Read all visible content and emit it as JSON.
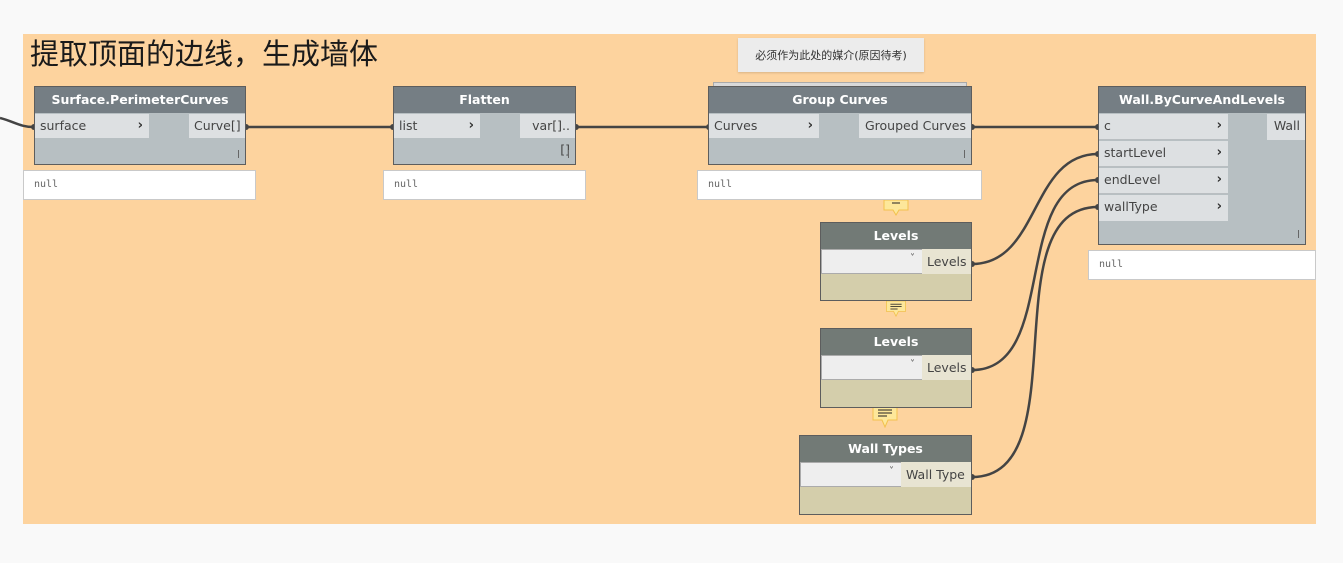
{
  "group": {
    "title": "提取顶面的边线，生成墙体",
    "background": "#fdd39e"
  },
  "note": {
    "text": "必须作为此处的媒介(原因待考)"
  },
  "nodes": {
    "perimeter_curves": {
      "title": "Surface.PerimeterCurves",
      "inputs": [
        "surface"
      ],
      "outputs": [
        "Curve[]"
      ],
      "preview": "null"
    },
    "flatten": {
      "title": "Flatten",
      "inputs": [
        "list"
      ],
      "outputs": [
        "var[]..[]"
      ],
      "preview": "null"
    },
    "group_curves": {
      "title": "Group Curves",
      "inputs": [
        "Curves"
      ],
      "outputs": [
        "Grouped Curves"
      ],
      "preview": "null"
    },
    "wall_by_curve": {
      "title": "Wall.ByCurveAndLevels",
      "inputs": [
        "c",
        "startLevel",
        "endLevel",
        "wallType"
      ],
      "outputs": [
        "Wall"
      ],
      "preview": "null"
    },
    "levels_1": {
      "title": "Levels",
      "selected": "",
      "output": "Levels"
    },
    "levels_2": {
      "title": "Levels",
      "selected": "",
      "output": "Levels"
    },
    "wall_types": {
      "title": "Wall Types",
      "selected": "",
      "output": "Wall Type"
    }
  },
  "icons": {
    "port_arrow": "›",
    "dropdown_chevron": "˅"
  },
  "colors": {
    "node_header": "#757e84",
    "node_body": "#b7bfc2",
    "port_bg": "#dde0e2",
    "selection_node_body": "#d4ceab",
    "wire": "#444444",
    "canvas": "#f9f9f9"
  }
}
